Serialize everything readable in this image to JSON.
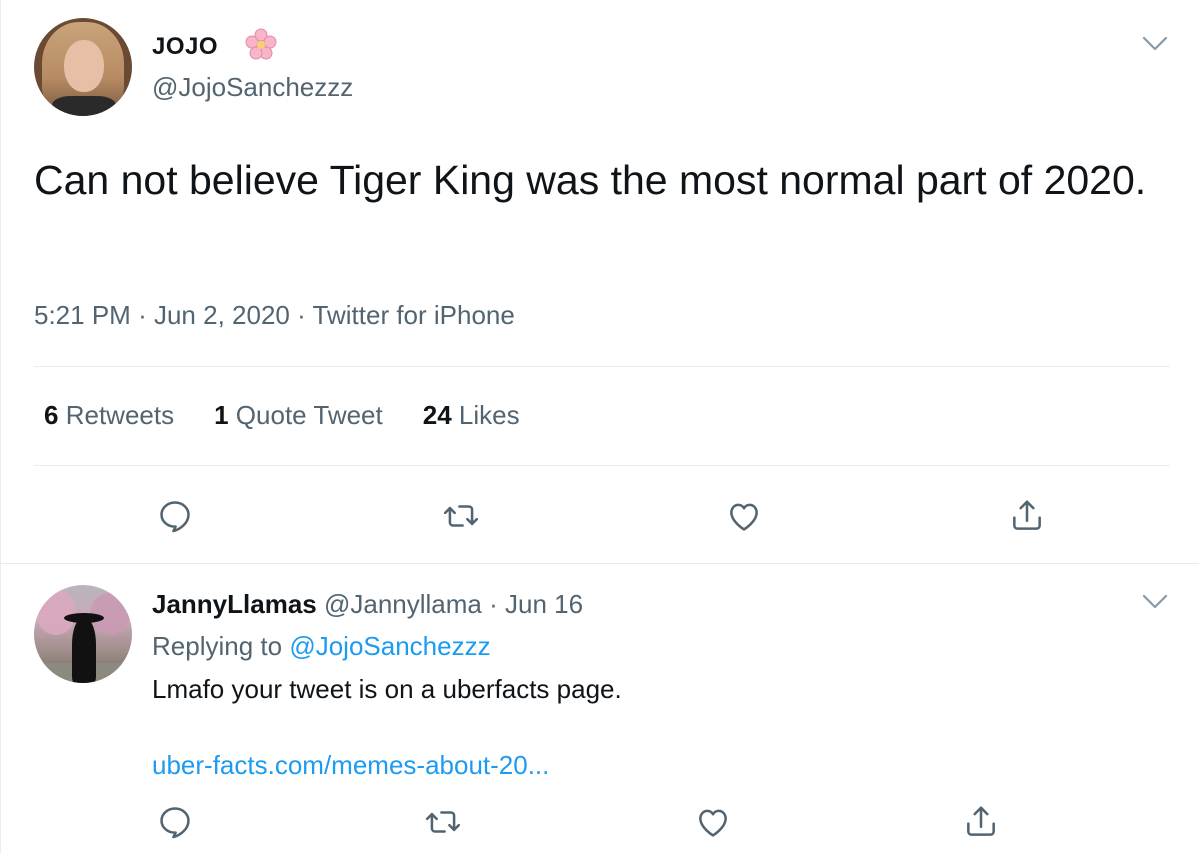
{
  "main_tweet": {
    "display_name": "JOJO",
    "name_emoji_icon": "cherry-blossom-icon",
    "handle": "@JojoSanchezzz",
    "text": "Can not believe Tiger King was the most normal part of 2020.",
    "time": "5:21 PM",
    "date": "Jun 2, 2020",
    "source": "Twitter for iPhone",
    "stats": {
      "retweets_count": "6",
      "retweets_label": "Retweets",
      "quotes_count": "1",
      "quotes_label": "Quote Tweet",
      "likes_count": "24",
      "likes_label": "Likes"
    }
  },
  "reply_tweet": {
    "display_name": "JannyLlamas",
    "handle": "@Jannyllama",
    "date": "Jun 16",
    "replying_prefix": "Replying to",
    "replying_handle": "@JojoSanchezzz",
    "text": "Lmafo your tweet is on a uberfacts page.",
    "link": "uber-facts.com/memes-about-20..."
  },
  "separator": "·",
  "colors": {
    "text": "#0f1419",
    "secondary": "#536471",
    "link": "#1d9bf0",
    "divider": "#e6ecf0"
  }
}
